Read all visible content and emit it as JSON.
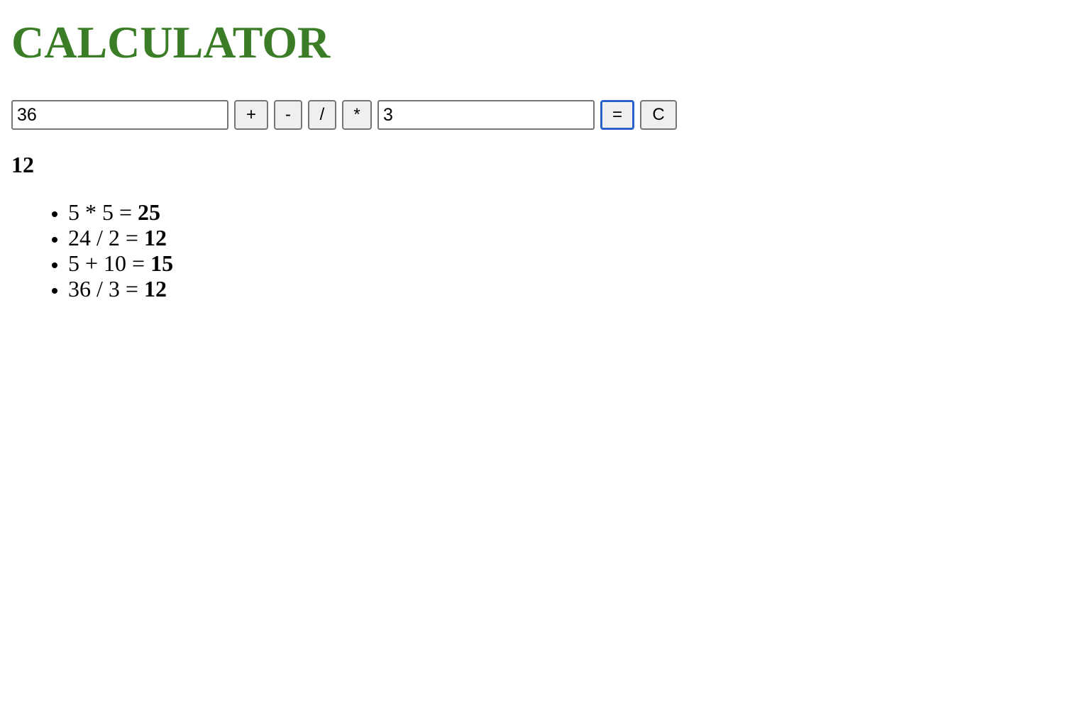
{
  "app": {
    "title": "CALCULATOR"
  },
  "controls": {
    "first_operand_value": "36",
    "second_operand_value": "3",
    "add_label": "+",
    "subtract_label": "-",
    "divide_label": "/",
    "multiply_label": "*",
    "equals_label": "=",
    "clear_label": "C"
  },
  "result": {
    "value": "12"
  },
  "history": [
    {
      "expression": "5 * 5 =",
      "answer": "25"
    },
    {
      "expression": "24 / 2 =",
      "answer": "12"
    },
    {
      "expression": "5 + 10 =",
      "answer": "15"
    },
    {
      "expression": "36 / 3 =",
      "answer": "12"
    }
  ],
  "colors": {
    "title": "#3a7d26",
    "focus_ring": "#2b62c9",
    "button_bg": "#efefef"
  }
}
